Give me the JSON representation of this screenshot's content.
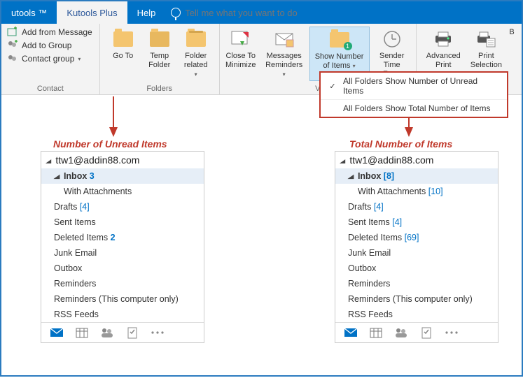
{
  "tabs": {
    "kutools": "utools ™",
    "kutools_plus": "Kutools Plus",
    "help": "Help",
    "tellme_placeholder": "Tell me what you want to do"
  },
  "ribbon": {
    "contact": {
      "add_from_message": "Add from Message",
      "add_to_group": "Add to Group",
      "contact_group": "Contact group",
      "label": "Contact"
    },
    "folders": {
      "goto": "Go To",
      "temp": "Temp\nFolder",
      "related": "Folder\nrelated",
      "label": "Folders"
    },
    "view": {
      "close": "Close To\nMinimize",
      "msg_rem": "Messages\nReminders",
      "show_num": "Show Number\nof Items",
      "sender_tz": "Sender\nTime Zone",
      "label": "V"
    },
    "print": {
      "adv": "Advanced\nPrint",
      "sel": "Print\nSelection"
    }
  },
  "dropdown": {
    "unread": "All Folders Show Number of Unread Items",
    "total": "All Folders Show Total Number of Items"
  },
  "annotations": {
    "left": "Number of Unread Items",
    "right": "Total Number of Items"
  },
  "panes": {
    "left": {
      "account": "ttw1@addin88.com",
      "folders": [
        {
          "name": "Inbox",
          "count": "3",
          "style": "blue-bold",
          "selected": true
        },
        {
          "name": "With Attachments",
          "count": "",
          "sub": true
        },
        {
          "name": "Drafts",
          "count": "[4]",
          "style": "blue-bracket"
        },
        {
          "name": "Sent Items",
          "count": ""
        },
        {
          "name": "Deleted Items",
          "count": "2",
          "style": "blue-bold"
        },
        {
          "name": "Junk Email",
          "count": ""
        },
        {
          "name": "Outbox",
          "count": ""
        },
        {
          "name": "Reminders",
          "count": ""
        },
        {
          "name": "Reminders (This computer only)",
          "count": ""
        },
        {
          "name": "RSS Feeds",
          "count": ""
        }
      ]
    },
    "right": {
      "account": "ttw1@addin88.com",
      "folders": [
        {
          "name": "Inbox",
          "count": "[8]",
          "style": "blue-bracket",
          "selected": true
        },
        {
          "name": "With Attachments",
          "count": "[10]",
          "style": "blue-bracket",
          "sub": true
        },
        {
          "name": "Drafts",
          "count": "[4]",
          "style": "blue-bracket"
        },
        {
          "name": "Sent Items",
          "count": "[4]",
          "style": "blue-bracket"
        },
        {
          "name": "Deleted Items",
          "count": "[69]",
          "style": "blue-bracket"
        },
        {
          "name": "Junk Email",
          "count": ""
        },
        {
          "name": "Outbox",
          "count": ""
        },
        {
          "name": "Reminders",
          "count": ""
        },
        {
          "name": "Reminders (This computer only)",
          "count": ""
        },
        {
          "name": "RSS Feeds",
          "count": ""
        }
      ]
    }
  }
}
